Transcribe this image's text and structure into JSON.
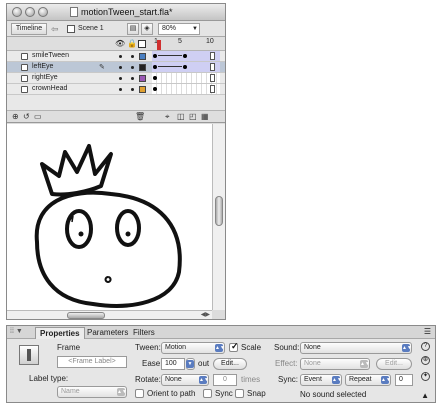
{
  "window": {
    "title": "motionTween_start.fla*"
  },
  "toolbar": {
    "timeline_button": "Timeline",
    "back_arrow": "⇦",
    "scene_label": "Scene 1",
    "zoom": "80%"
  },
  "timeline": {
    "ruler": [
      "1",
      "5",
      "10"
    ],
    "layers": [
      {
        "name": "smileTween",
        "color": "#4a7fc1",
        "tween": true,
        "selected": false
      },
      {
        "name": "leftEye",
        "color": "#222222",
        "tween": true,
        "selected": true
      },
      {
        "name": "rightEye",
        "color": "#9b59b6",
        "tween": false,
        "selected": false
      },
      {
        "name": "crownHead",
        "color": "#e0a030",
        "tween": false,
        "selected": false
      }
    ]
  },
  "properties": {
    "tabs": [
      "Properties",
      "Parameters",
      "Filters"
    ],
    "frame_label": "Frame",
    "frame_label_placeholder": "<Frame Label>",
    "label_type_label": "Label type:",
    "label_type_value": "Name",
    "tween_label": "Tween:",
    "tween_value": "Motion",
    "scale_label": "Scale",
    "ease_label": "Ease:",
    "ease_value": "100",
    "ease_suffix": "out",
    "edit_button": "Edit...",
    "rotate_label": "Rotate:",
    "rotate_value": "None",
    "times_value": "0",
    "times_label": "times",
    "orient_label": "Orient to path",
    "sync_check_label": "Sync",
    "snap_label": "Snap",
    "sound_label": "Sound:",
    "sound_value": "None",
    "effect_label": "Effect:",
    "effect_value": "None",
    "effect_edit_button": "Edit...",
    "sync_label": "Sync:",
    "sync_value": "Event",
    "repeat_value": "Repeat",
    "repeat_count": "0",
    "sound_status": "No sound selected"
  }
}
